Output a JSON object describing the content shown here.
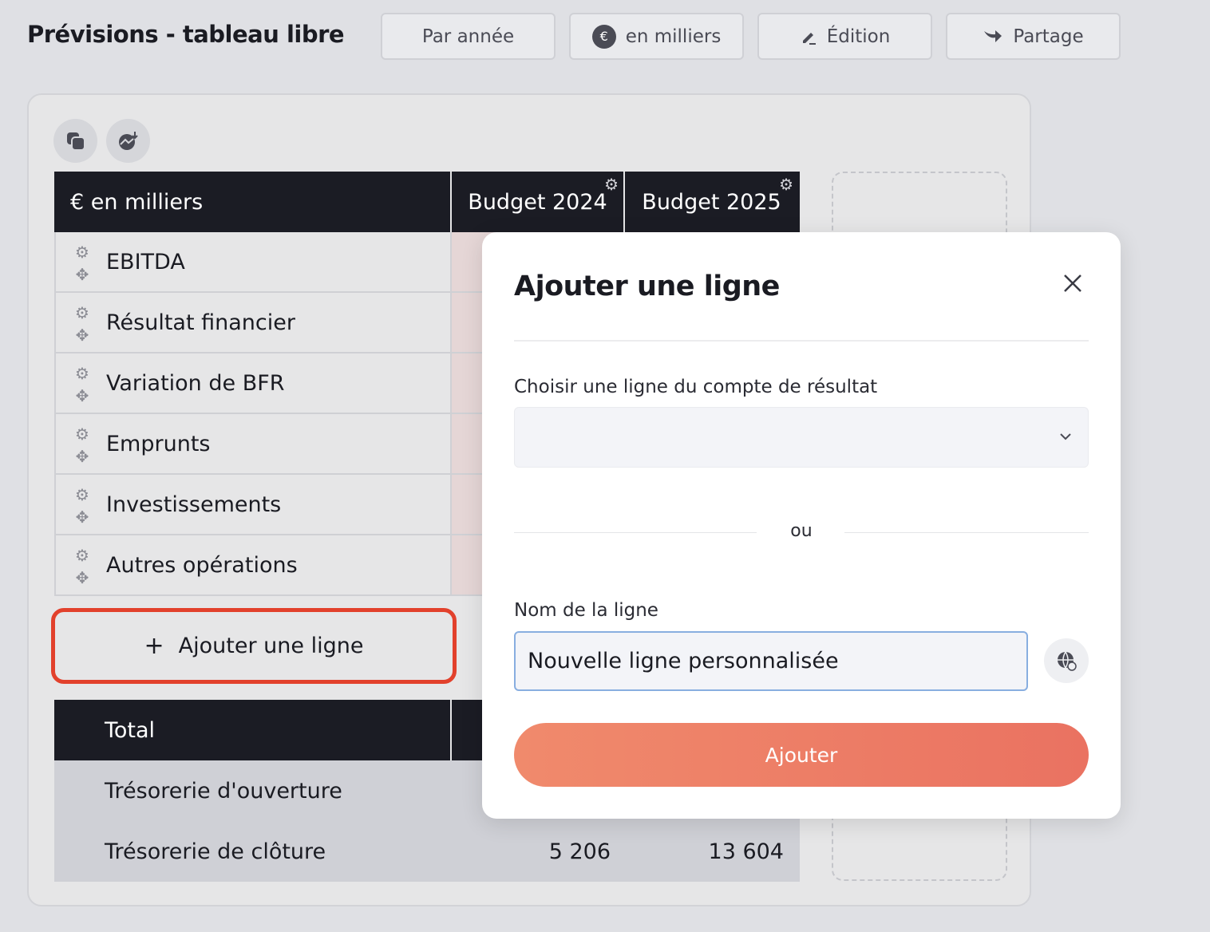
{
  "header": {
    "title": "Prévisions - tableau libre",
    "buttons": {
      "period": "Par année",
      "unit": "en milliers",
      "edit": "Édition",
      "share": "Partage"
    }
  },
  "table": {
    "unit_label": "€ en milliers",
    "columns": [
      "Budget 2024",
      "Budget 2025"
    ],
    "rows": [
      {
        "label": "EBITDA"
      },
      {
        "label": "Résultat financier"
      },
      {
        "label": "Variation de BFR"
      },
      {
        "label": "Emprunts"
      },
      {
        "label": "Investissements"
      },
      {
        "label": "Autres opérations"
      }
    ],
    "add_line_label": "Ajouter une ligne",
    "total_label": "Total",
    "footer": [
      {
        "label": "Trésorerie d'ouverture",
        "values": [
          "",
          ""
        ]
      },
      {
        "label": "Trésorerie de clôture",
        "values": [
          "5 206",
          "13 604"
        ]
      }
    ]
  },
  "modal": {
    "title": "Ajouter une ligne",
    "select_label": "Choisir une ligne du compte de résultat",
    "select_value": "",
    "or_text": "ou",
    "name_label": "Nom de la ligne",
    "name_value": "Nouvelle ligne personnalisée",
    "submit_label": "Ajouter"
  },
  "colors": {
    "accent": "#ea7261",
    "highlight_border": "#e2412c",
    "dark_header": "#1b1c24"
  }
}
